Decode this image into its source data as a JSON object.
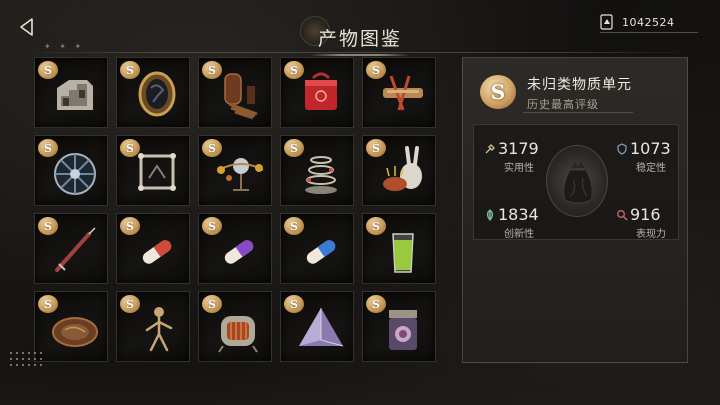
{
  "header": {
    "title": "产物图鉴",
    "back_icon": "back-arrow-icon",
    "currency": {
      "icon": "card-icon",
      "value": "1042524"
    }
  },
  "grid": {
    "items": [
      {
        "rank": "S",
        "icon": "staircase-model-icon"
      },
      {
        "rank": "S",
        "icon": "ornate-mirror-icon"
      },
      {
        "rank": "S",
        "icon": "door-stairs-icon"
      },
      {
        "rank": "S",
        "icon": "red-box-icon"
      },
      {
        "rank": "S",
        "icon": "bound-wood-icon"
      },
      {
        "rank": "S",
        "icon": "broken-wheel-icon"
      },
      {
        "rank": "S",
        "icon": "picture-frame-icon"
      },
      {
        "rank": "S",
        "icon": "orrery-icon"
      },
      {
        "rank": "S",
        "icon": "spiral-tower-icon"
      },
      {
        "rank": "S",
        "icon": "rabbit-pincushion-icon"
      },
      {
        "rank": "S",
        "icon": "syringe-icon"
      },
      {
        "rank": "S",
        "icon": "red-pill-icon"
      },
      {
        "rank": "S",
        "icon": "purple-pill-icon"
      },
      {
        "rank": "S",
        "icon": "blue-pill-icon"
      },
      {
        "rank": "S",
        "icon": "green-drink-icon"
      },
      {
        "rank": "S",
        "icon": "bronze-plate-icon"
      },
      {
        "rank": "S",
        "icon": "skeleton-puppet-icon"
      },
      {
        "rank": "S",
        "icon": "radio-device-icon"
      },
      {
        "rank": "S",
        "icon": "crystal-pyramid-icon"
      },
      {
        "rank": "S",
        "icon": "specimen-jar-icon"
      }
    ]
  },
  "panel": {
    "rank": "S",
    "name": "未归类物质单元",
    "subtitle": "历史最高评级",
    "center_icon": "garbage-bag-icon",
    "stats": [
      {
        "icon": "wrench-icon",
        "value": "3179",
        "label": "实用性"
      },
      {
        "icon": "shield-icon",
        "value": "1073",
        "label": "稳定性"
      },
      {
        "icon": "leaf-icon",
        "value": "1834",
        "label": "创新性"
      },
      {
        "icon": "search-icon",
        "value": "916",
        "label": "表现力"
      }
    ]
  },
  "colors": {
    "badge_gold": "#c89a58",
    "panel_bg": "#2d2a27",
    "stat_wrench": "#c9b98a",
    "stat_shield": "#8fa3c4",
    "stat_leaf": "#7fbf9a",
    "stat_search": "#d06a6a"
  }
}
